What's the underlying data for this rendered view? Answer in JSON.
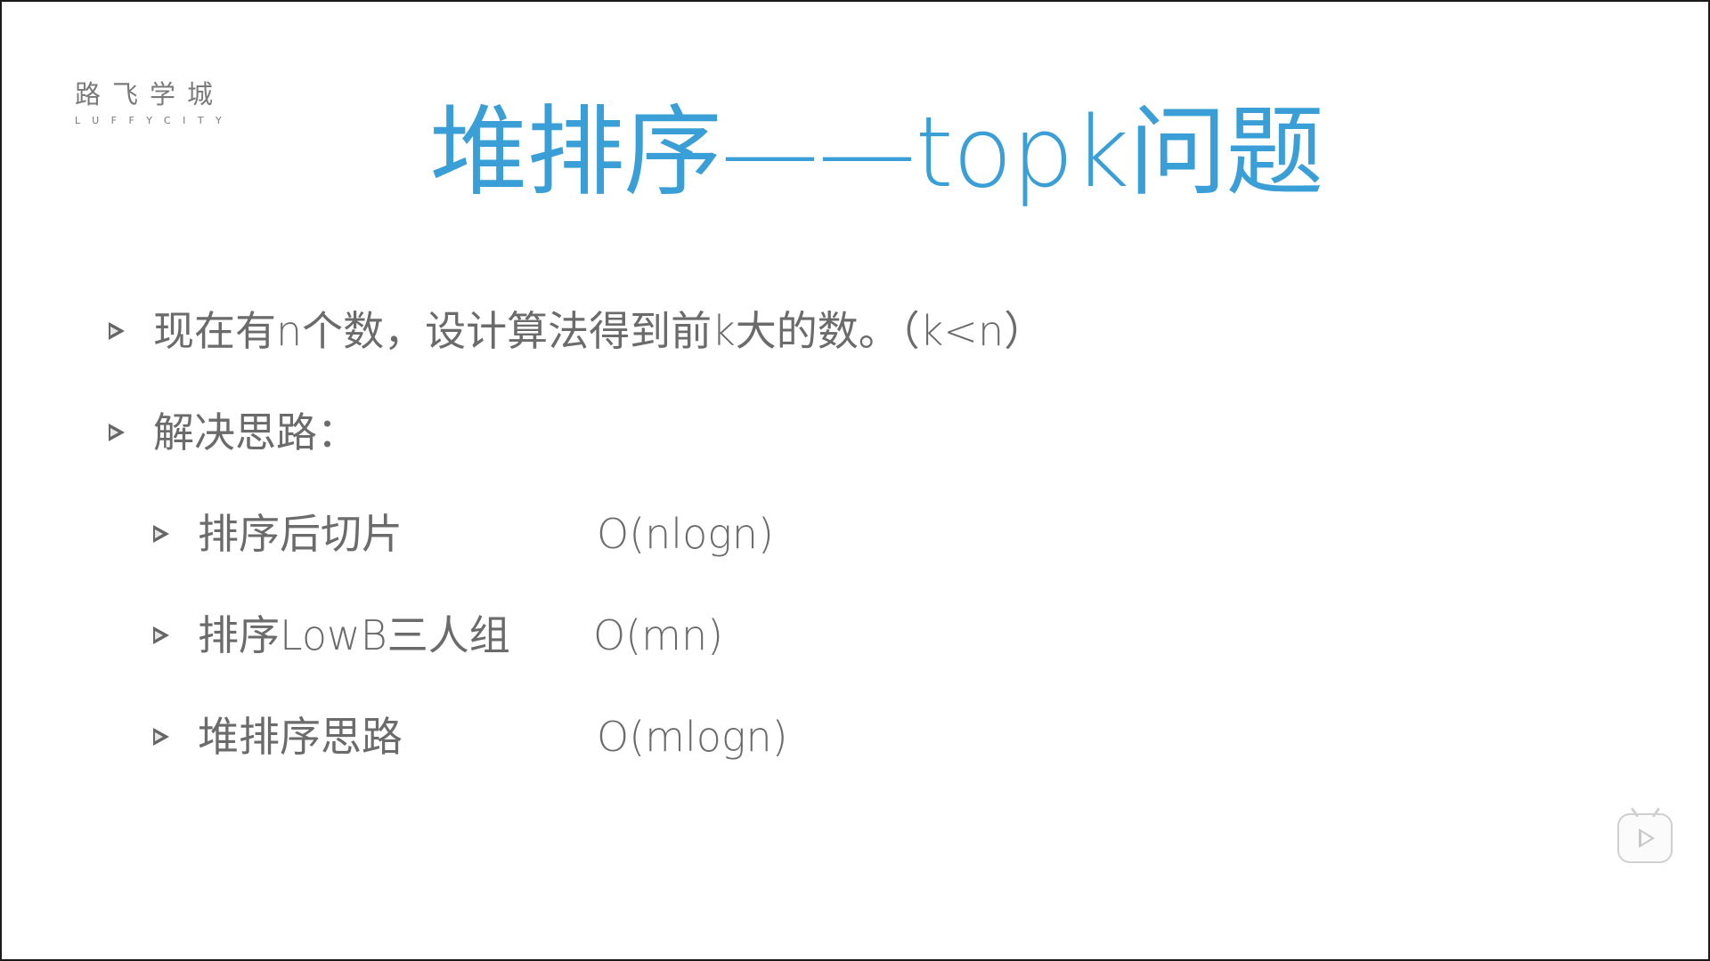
{
  "logo": {
    "name_cn": "路飞学城",
    "name_en": "LUFFYCITY"
  },
  "slide": {
    "title": "堆排序——topk问题",
    "title_color": "#3a9fd6",
    "text_color": "#6b6b6b",
    "bullets": [
      {
        "text": "现在有n个数，设计算法得到前k大的数。（k<n）"
      },
      {
        "text": "解决思路："
      }
    ],
    "sub_bullets": [
      {
        "text": "排序后切片",
        "complexity": "O(nlogn)"
      },
      {
        "text": "排序LowB三人组",
        "complexity": "O(mn)"
      },
      {
        "text": "堆排序思路",
        "complexity": "O(mlogn)"
      }
    ]
  },
  "controls": {
    "play_icon": "play-icon"
  }
}
